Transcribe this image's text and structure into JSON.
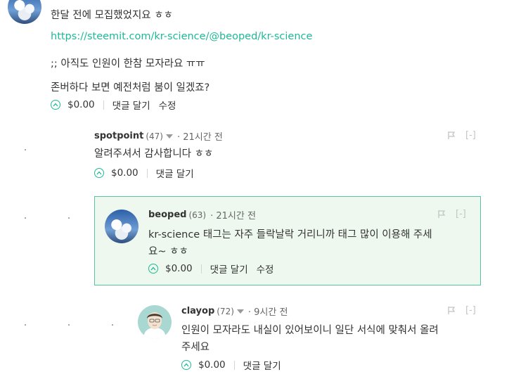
{
  "comments": [
    {
      "text_lines": [
        "한달 전에 모집했었지요 ㅎㅎ"
      ],
      "link": "https://steemit.com/kr-science/@beoped/kr-science",
      "text_lines_2": [
        ";; 아직도 인원이 한참 모자라요 ㅠㅠ",
        "존버하다 보면 예전처럼 붐이 일겠죠?"
      ],
      "payout": "$0.00",
      "reply": "댓글 달기",
      "edit": "수정"
    },
    {
      "author": "spotpoint",
      "reputation": "(47)",
      "time": "21시간 전",
      "text_lines": [
        "알려주셔서 감사합니다 ㅎㅎ"
      ],
      "payout": "$0.00",
      "reply": "댓글 달기",
      "flag_hide": "[-]"
    },
    {
      "author": "beoped",
      "reputation": "(63)",
      "time": "21시간 전",
      "text_lines": [
        "kr-science 태그는 자주 들락날락 거리니까 태그 많이 이용해 주세",
        "요~ ㅎㅎ"
      ],
      "payout": "$0.00",
      "reply": "댓글 달기",
      "edit": "수정",
      "flag_hide": "[-]"
    },
    {
      "author": "clayop",
      "reputation": "(72)",
      "time": "9시간 전",
      "text_lines": [
        "인원이 모자라도 내실이 있어보이니 일단 서식에 맞춰서 올려",
        "주세요"
      ],
      "payout": "$0.00",
      "reply": "댓글 달기",
      "flag_hide": "[-]"
    }
  ],
  "colors": {
    "accent": "#1fb898",
    "highlight_bg": "#eef8ef",
    "highlight_border": "#58c2a8"
  }
}
